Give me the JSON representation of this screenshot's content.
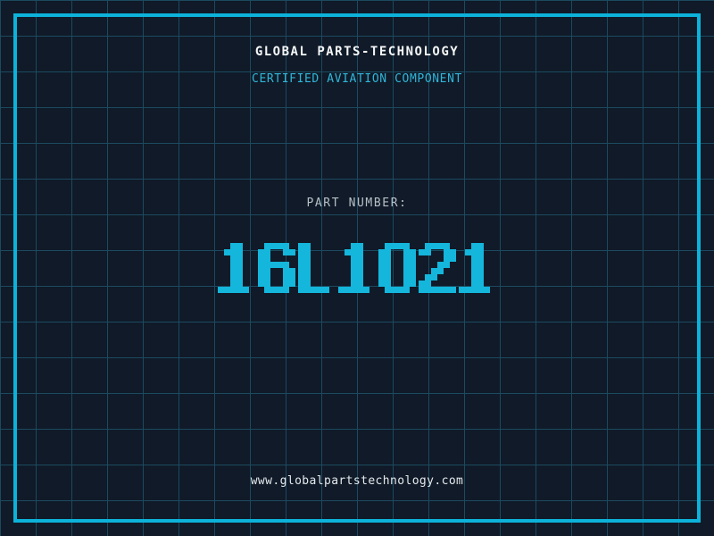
{
  "colors": {
    "bg": "#101a28",
    "grid": "#1c4a60",
    "accent": "#0cb2da",
    "title": "#f4f6f7",
    "cyanText": "#2fb6d9",
    "grayText": "#b6c0c8",
    "urlText": "#e4e9ec",
    "digit": "#14b6dc"
  },
  "header": {
    "title": "GLOBAL PARTS-TECHNOLOGY",
    "subtitle": "CERTIFIED AVIATION COMPONENT"
  },
  "part": {
    "label": "PART NUMBER:",
    "value": "16L1021"
  },
  "footer": {
    "url": "www.globalpartstechnology.com"
  }
}
